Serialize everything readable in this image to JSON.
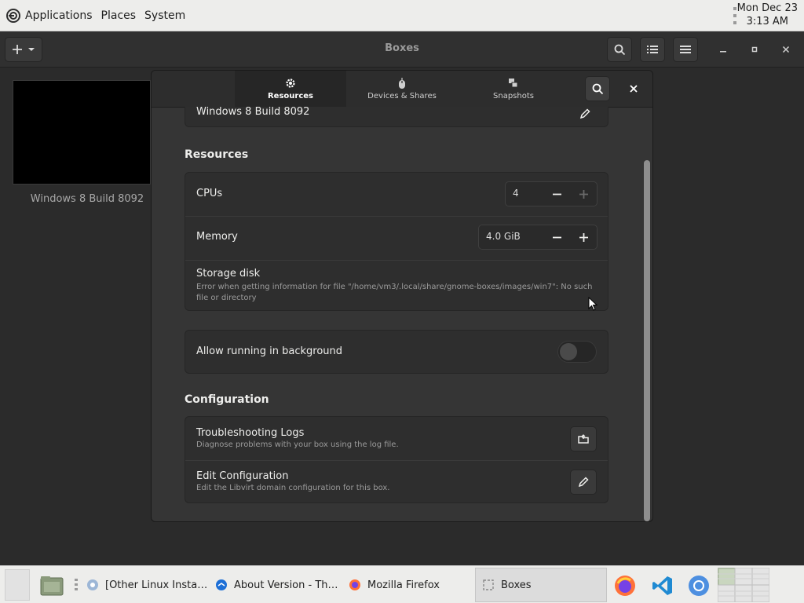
{
  "top_panel": {
    "menus": [
      "Applications",
      "Places",
      "System"
    ],
    "clock": {
      "date": "Mon Dec 23",
      "time": "3:13 AM"
    }
  },
  "window": {
    "title": "Boxes"
  },
  "vm_list": {
    "items": [
      {
        "name": "Windows 8 Build 8092"
      }
    ]
  },
  "dialog": {
    "tabs": [
      {
        "label": "Resources",
        "icon": "gear-icon",
        "active": true
      },
      {
        "label": "Devices & Shares",
        "icon": "mouse-icon",
        "active": false
      },
      {
        "label": "Snapshots",
        "icon": "snapshots-icon",
        "active": false
      }
    ],
    "name_row": {
      "value": "Windows 8 Build 8092"
    },
    "resources": {
      "heading": "Resources",
      "cpus": {
        "label": "CPUs",
        "value": "4"
      },
      "memory": {
        "label": "Memory",
        "value": "4.0 GiB"
      },
      "storage": {
        "label": "Storage disk",
        "error": "Error when getting information for file \"/home/vm3/.local/share/gnome-boxes/images/win7\": No such file or directory"
      }
    },
    "background": {
      "label": "Allow running in background",
      "enabled": false
    },
    "configuration": {
      "heading": "Configuration",
      "logs": {
        "label": "Troubleshooting Logs",
        "sub": "Diagnose problems with your box using the log file."
      },
      "edit": {
        "label": "Edit Configuration",
        "sub": "Edit the Libvirt domain configuration for this box."
      }
    }
  },
  "taskbar": {
    "tasks": [
      {
        "label": "[Other Linux Install..."
      },
      {
        "label": "About Version - Tho..."
      },
      {
        "label": "Mozilla Firefox"
      },
      {
        "label": "Boxes"
      }
    ]
  },
  "colors": {
    "panel_bg": "#ededeb",
    "window_bg": "#2b2b2b",
    "dialog_bg": "#353535",
    "card_bg": "#2e2e2e"
  }
}
